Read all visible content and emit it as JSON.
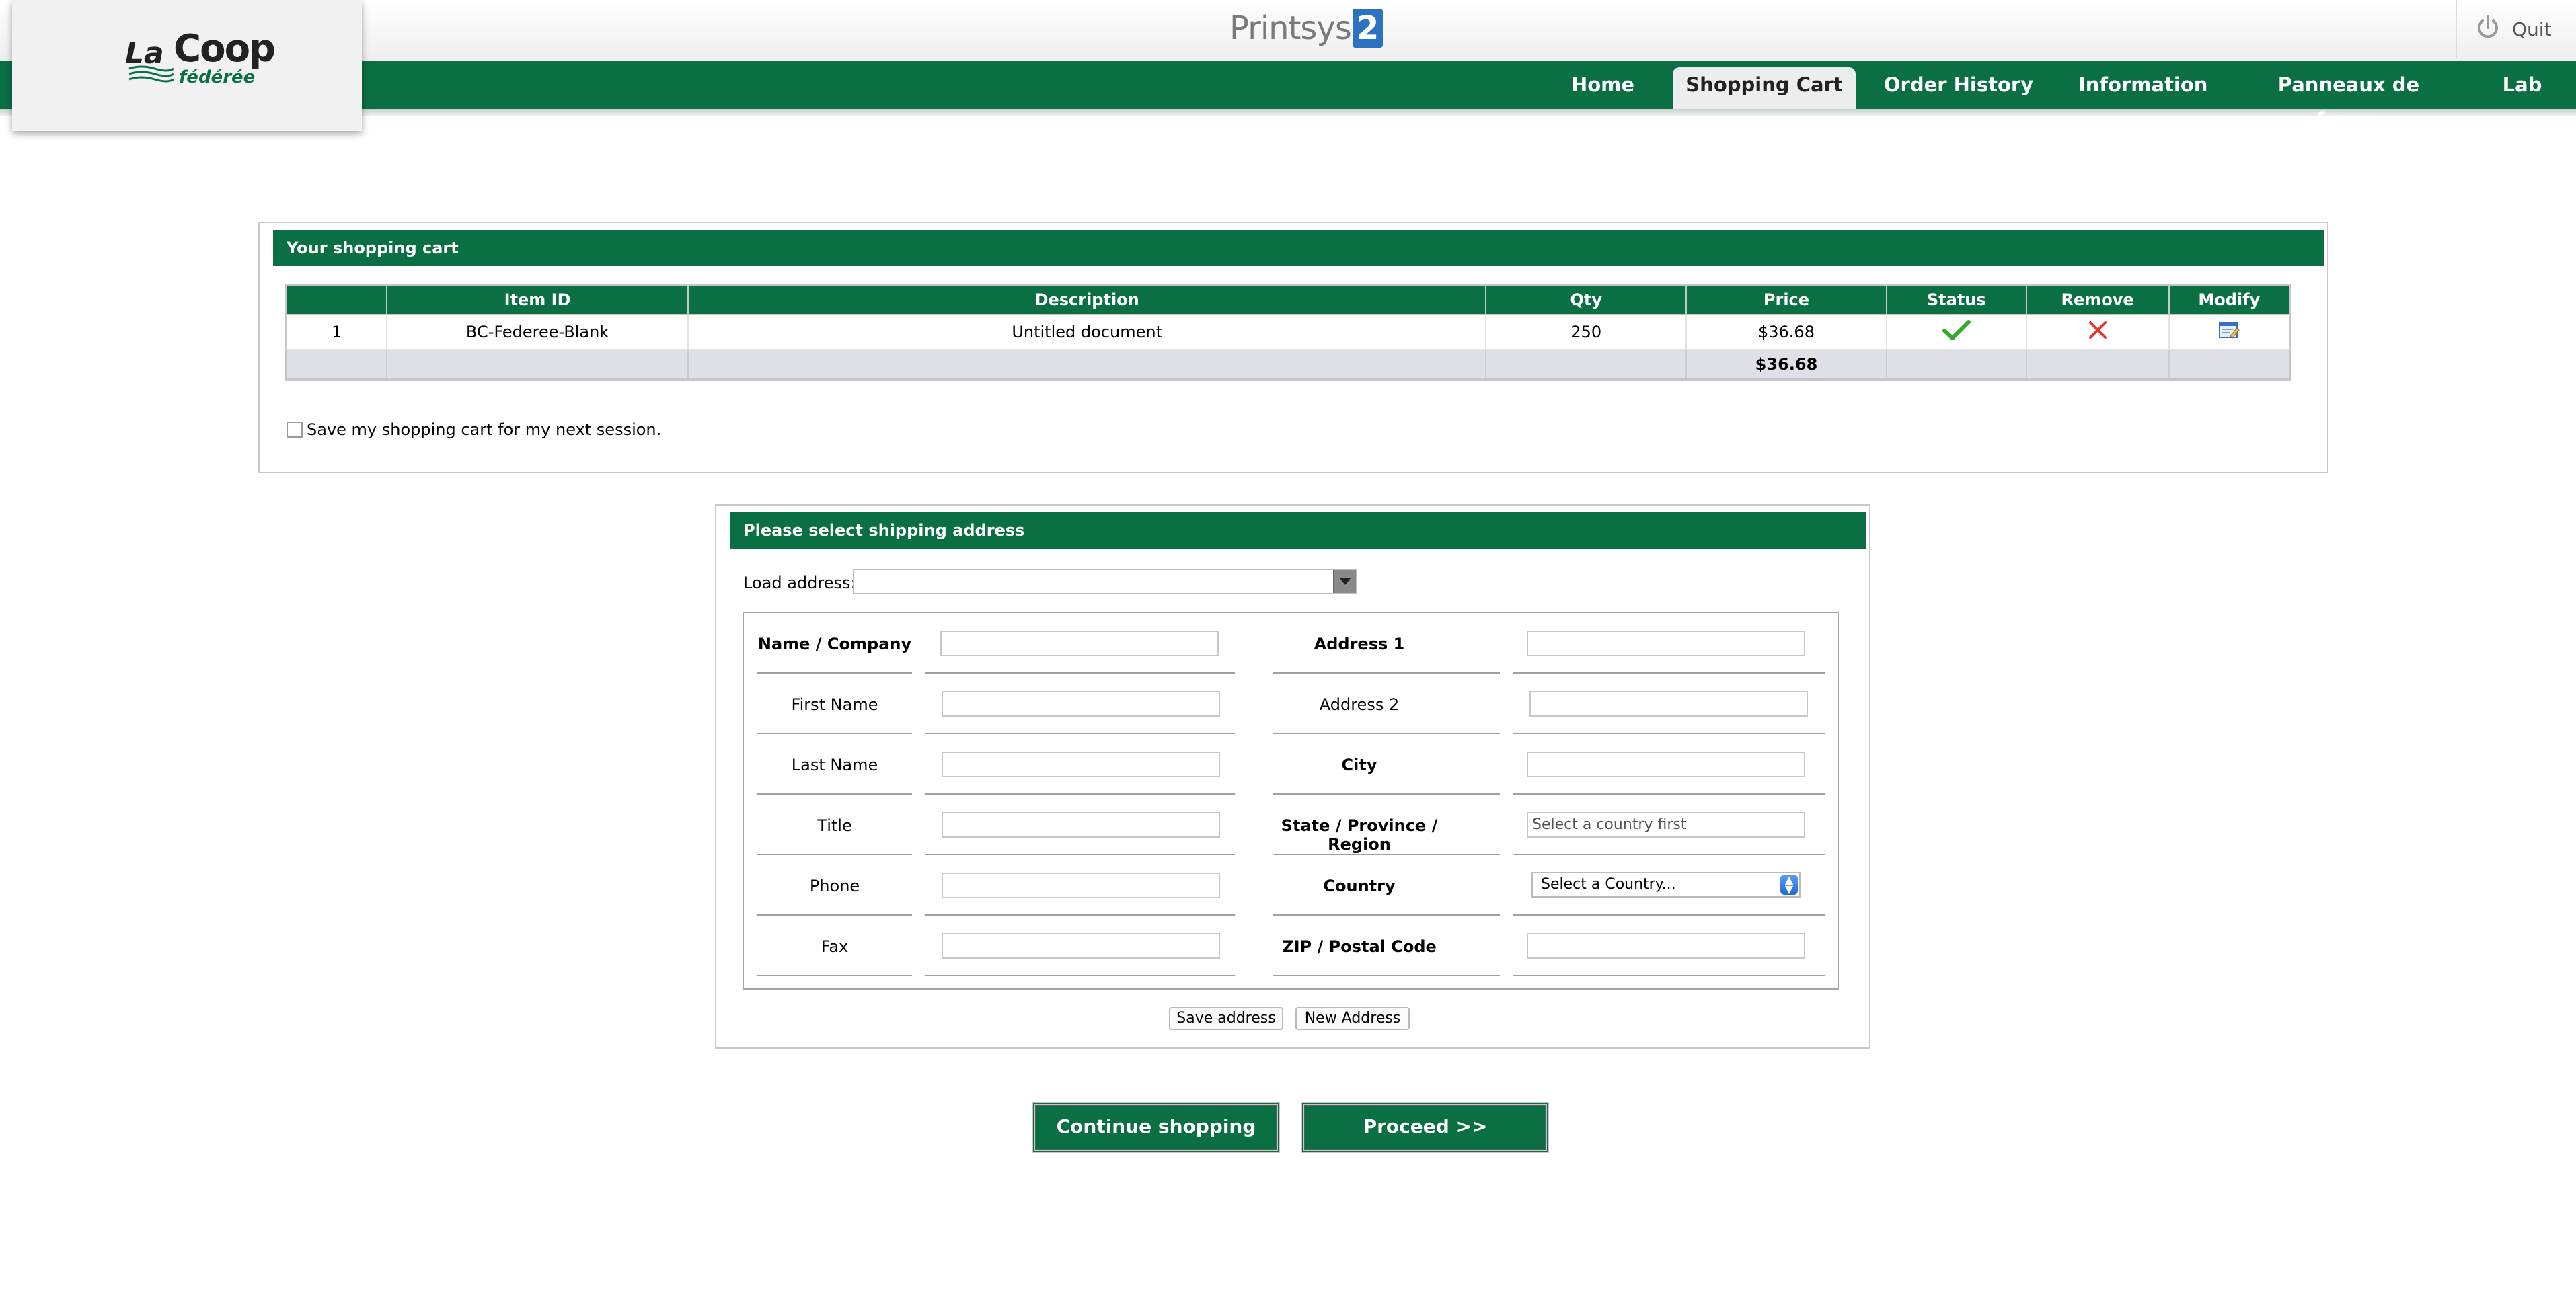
{
  "app": {
    "brand_name": "Printsys",
    "brand_version": "2",
    "logo_primary": "Coop",
    "logo_prefix": "La",
    "logo_sub": "fédérée",
    "quit_label": "Quit",
    "accent_color": "#0b6f44"
  },
  "nav": {
    "items": [
      {
        "label": "Home",
        "active": false
      },
      {
        "label": "Shopping Cart",
        "active": true
      },
      {
        "label": "Order History",
        "active": false
      },
      {
        "label": "Information",
        "active": false
      },
      {
        "label": "Panneaux de ferme",
        "active": false
      },
      {
        "label": "Lab",
        "active": false
      }
    ]
  },
  "cart": {
    "title": "Your shopping cart",
    "columns": [
      "",
      "Item ID",
      "Description",
      "Qty",
      "Price",
      "Status",
      "Remove",
      "Modify"
    ],
    "rows": [
      {
        "index": "1",
        "item_id": "BC-Federee-Blank",
        "description": "Untitled document",
        "qty": "250",
        "price": "$36.68",
        "status_icon": "check-icon",
        "remove_icon": "remove-x-icon",
        "modify_icon": "edit-icon"
      }
    ],
    "total": "$36.68",
    "save_cart_label": "Save my shopping cart for my next session.",
    "save_cart_checked": false
  },
  "shipping": {
    "title": "Please select shipping address",
    "load_label": "Load address:",
    "load_value": "",
    "left_fields": [
      {
        "label": "Name / Company",
        "required": true,
        "value": ""
      },
      {
        "label": "First Name",
        "required": false,
        "value": ""
      },
      {
        "label": "Last Name",
        "required": false,
        "value": ""
      },
      {
        "label": "Title",
        "required": false,
        "value": ""
      },
      {
        "label": "Phone",
        "required": false,
        "value": ""
      },
      {
        "label": "Fax",
        "required": false,
        "value": ""
      }
    ],
    "right_fields": [
      {
        "label": "Address 1",
        "required": true,
        "value": ""
      },
      {
        "label": "Address 2",
        "required": false,
        "value": ""
      },
      {
        "label": "City",
        "required": true,
        "value": ""
      },
      {
        "label": "State / Province / Region",
        "required": true,
        "value": "Select a country first"
      },
      {
        "label": "Country",
        "required": true,
        "value": "Select a Country..."
      },
      {
        "label": "ZIP / Postal Code",
        "required": true,
        "value": ""
      }
    ],
    "save_address_label": "Save address",
    "new_address_label": "New Address"
  },
  "actions": {
    "continue_label": "Continue shopping",
    "proceed_label": "Proceed >>"
  }
}
